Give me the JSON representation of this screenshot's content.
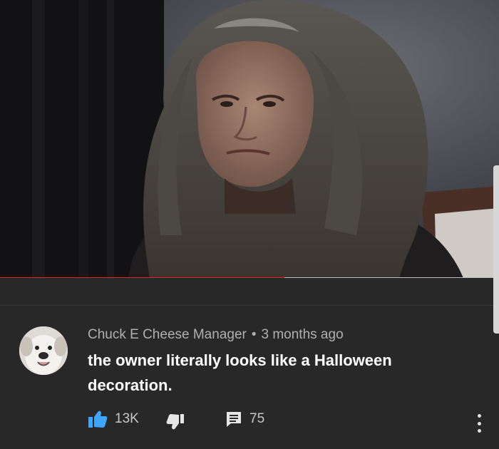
{
  "video": {
    "progress_fraction": 0.57
  },
  "comment": {
    "author": "Chuck E Cheese Manager",
    "separator": "•",
    "time": "3 months ago",
    "text": "the owner literally looks like a Halloween decoration."
  },
  "actions": {
    "like_count": "13K",
    "reply_count": "75"
  },
  "colors": {
    "background": "#282828",
    "accent_like": "#3ea6ff",
    "progress": "#e52521"
  },
  "icons": {
    "like": "thumbs-up-icon",
    "dislike": "thumbs-down-icon",
    "reply": "comment-icon",
    "more": "more-vert-icon"
  }
}
